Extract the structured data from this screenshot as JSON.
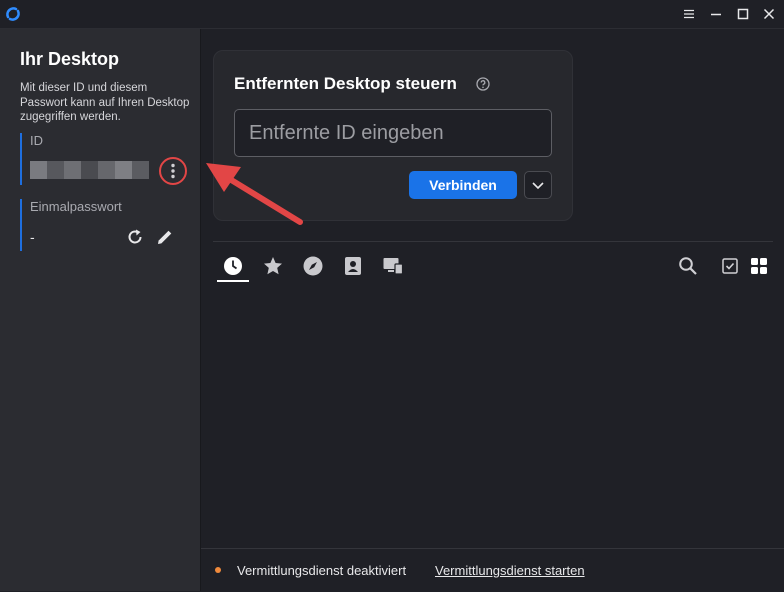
{
  "titlebar": {
    "icons": [
      "app-logo-icon",
      "menu-icon",
      "minimize-icon",
      "maximize-icon",
      "close-icon"
    ]
  },
  "sidebar": {
    "title": "Ihr Desktop",
    "description": "Mit dieser ID und diesem Passwort kann auf Ihren Desktop zugegriffen werden.",
    "id_label": "ID",
    "id_value_redacted": true,
    "password_label": "Einmalpasswort",
    "password_value": "-",
    "icons": [
      "more-options-icon",
      "refresh-icon",
      "edit-pencil-icon"
    ]
  },
  "connect_card": {
    "title": "Entfernten Desktop steuern",
    "input_placeholder": "Entfernte ID eingeben",
    "input_value": "",
    "connect_label": "Verbinden",
    "icons": [
      "help-icon",
      "chevron-down-icon"
    ]
  },
  "tabs": {
    "active": "recent-sessions",
    "items": [
      "clock-icon",
      "star-icon",
      "compass-icon",
      "address-book-icon",
      "lan-devices-icon"
    ],
    "tools": [
      "search-icon",
      "checkbox-icon",
      "grid-view-icon"
    ]
  },
  "status": {
    "text": "Vermittlungsdienst deaktiviert",
    "link": "Vermittlungsdienst starten",
    "dot_color": "#f08a3c"
  },
  "colors": {
    "accent": "#1a73e8",
    "annotation": "#e24646"
  }
}
